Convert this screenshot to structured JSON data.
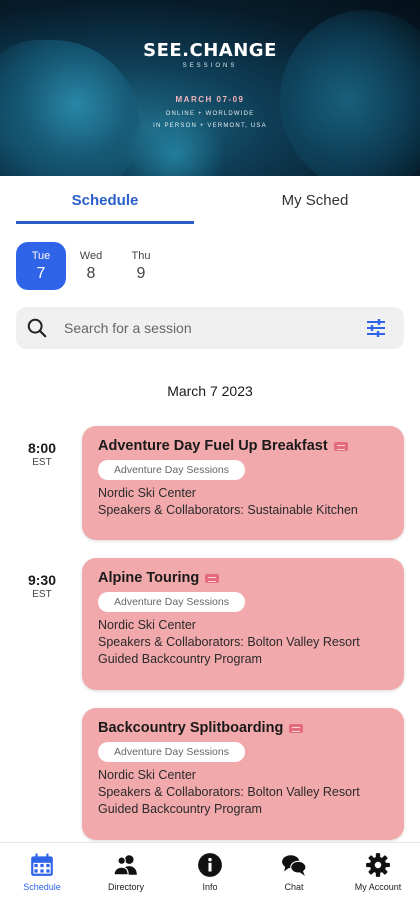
{
  "banner": {
    "brand": "SEE.CHANGE",
    "subtitle": "SESSIONS",
    "dates": "MARCH 07-09",
    "line1": "ONLINE + WORLDWIDE",
    "line2": "IN PERSON + VERMONT, USA"
  },
  "tabs": [
    {
      "label": "Schedule",
      "active": true
    },
    {
      "label": "My Sched",
      "active": false
    }
  ],
  "days": [
    {
      "name": "Tue",
      "num": "7",
      "active": true
    },
    {
      "name": "Wed",
      "num": "8",
      "active": false
    },
    {
      "name": "Thu",
      "num": "9",
      "active": false
    }
  ],
  "search": {
    "placeholder": "Search for a session"
  },
  "date_heading": "March 7 2023",
  "sessions": [
    {
      "time": "8:00",
      "tz": "EST",
      "title": "Adventure Day Fuel Up Breakfast",
      "track": "Adventure Day Sessions",
      "location": "Nordic Ski Center",
      "speakers": "Speakers & Collaborators: Sustainable Kitchen",
      "extra": ""
    },
    {
      "time": "9:30",
      "tz": "EST",
      "title": "Alpine Touring",
      "track": "Adventure Day Sessions",
      "location": "Nordic Ski Center",
      "speakers": "Speakers & Collaborators: Bolton Valley Resort",
      "extra": "Guided Backcountry Program"
    },
    {
      "time": "",
      "tz": "",
      "title": "Backcountry Splitboarding",
      "track": "Adventure Day Sessions",
      "location": "Nordic Ski Center",
      "speakers": "Speakers & Collaborators: Bolton Valley Resort",
      "extra": "Guided Backcountry Program"
    }
  ],
  "nav": [
    {
      "label": "Schedule",
      "icon": "calendar-icon",
      "active": true
    },
    {
      "label": "Directory",
      "icon": "people-icon",
      "active": false
    },
    {
      "label": "Info",
      "icon": "info-icon",
      "active": false
    },
    {
      "label": "Chat",
      "icon": "chat-icon",
      "active": false
    },
    {
      "label": "My Account",
      "icon": "gear-icon",
      "active": false
    }
  ],
  "colors": {
    "accent": "#2f63e8",
    "card": "#f2a9ac"
  }
}
